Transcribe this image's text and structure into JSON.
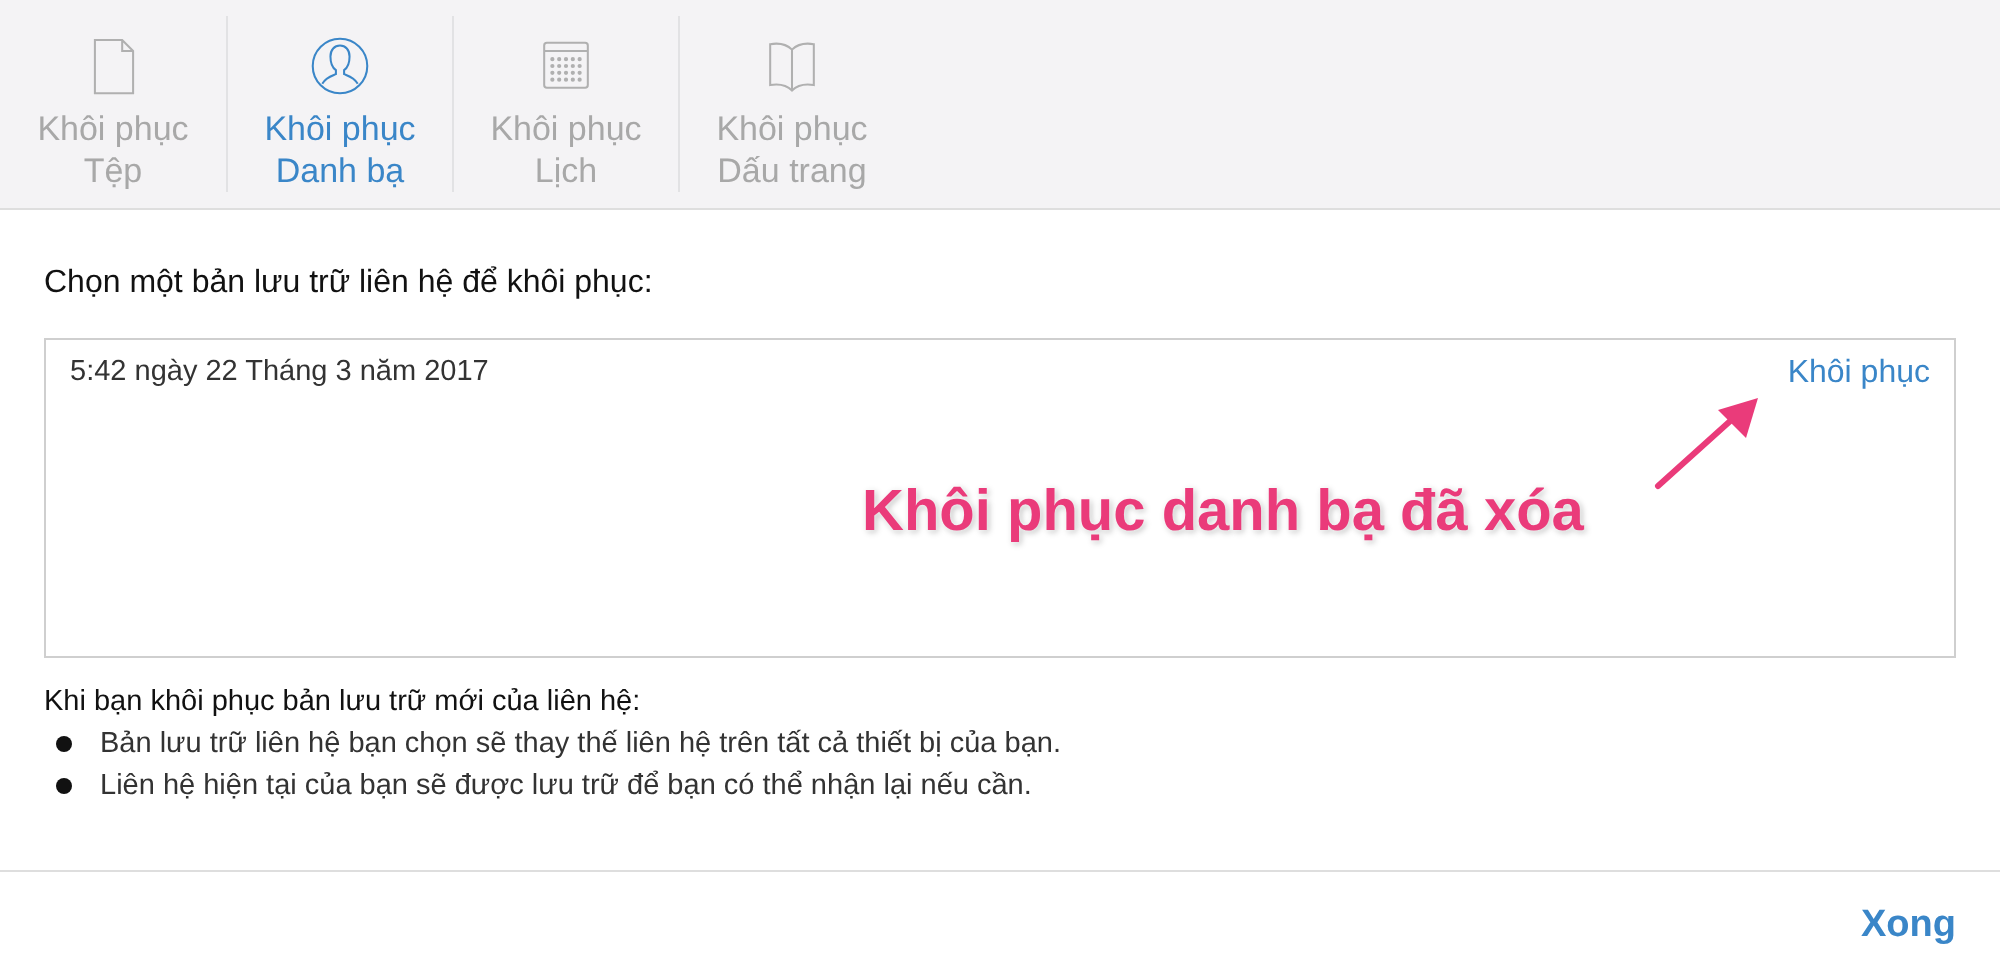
{
  "tabs": [
    {
      "kind": "file",
      "label": "Khôi phục\nTệp",
      "selected": false
    },
    {
      "kind": "contacts",
      "label": "Khôi phục\nDanh bạ",
      "selected": true
    },
    {
      "kind": "calendar",
      "label": "Khôi phục\nLịch",
      "selected": false
    },
    {
      "kind": "bookmarks",
      "label": "Khôi phục\nDấu trang",
      "selected": false
    }
  ],
  "heading": "Chọn một bản lưu trữ liên hệ để khôi phục:",
  "archives": [
    {
      "date": "5:42 ngày 22 Tháng 3 năm 2017",
      "action": "Khôi phục"
    }
  ],
  "annotation": "Khôi phục danh bạ đã xóa",
  "notes": {
    "title": "Khi bạn khôi phục bản lưu trữ mới của liên hệ:",
    "items": [
      "Bản lưu trữ liên hệ bạn chọn sẽ thay thế liên hệ trên tất cả thiết bị của bạn.",
      "Liên hệ hiện tại của bạn sẽ được lưu trữ để bạn có thể nhận lại nếu cần."
    ]
  },
  "done_button": "Xong"
}
